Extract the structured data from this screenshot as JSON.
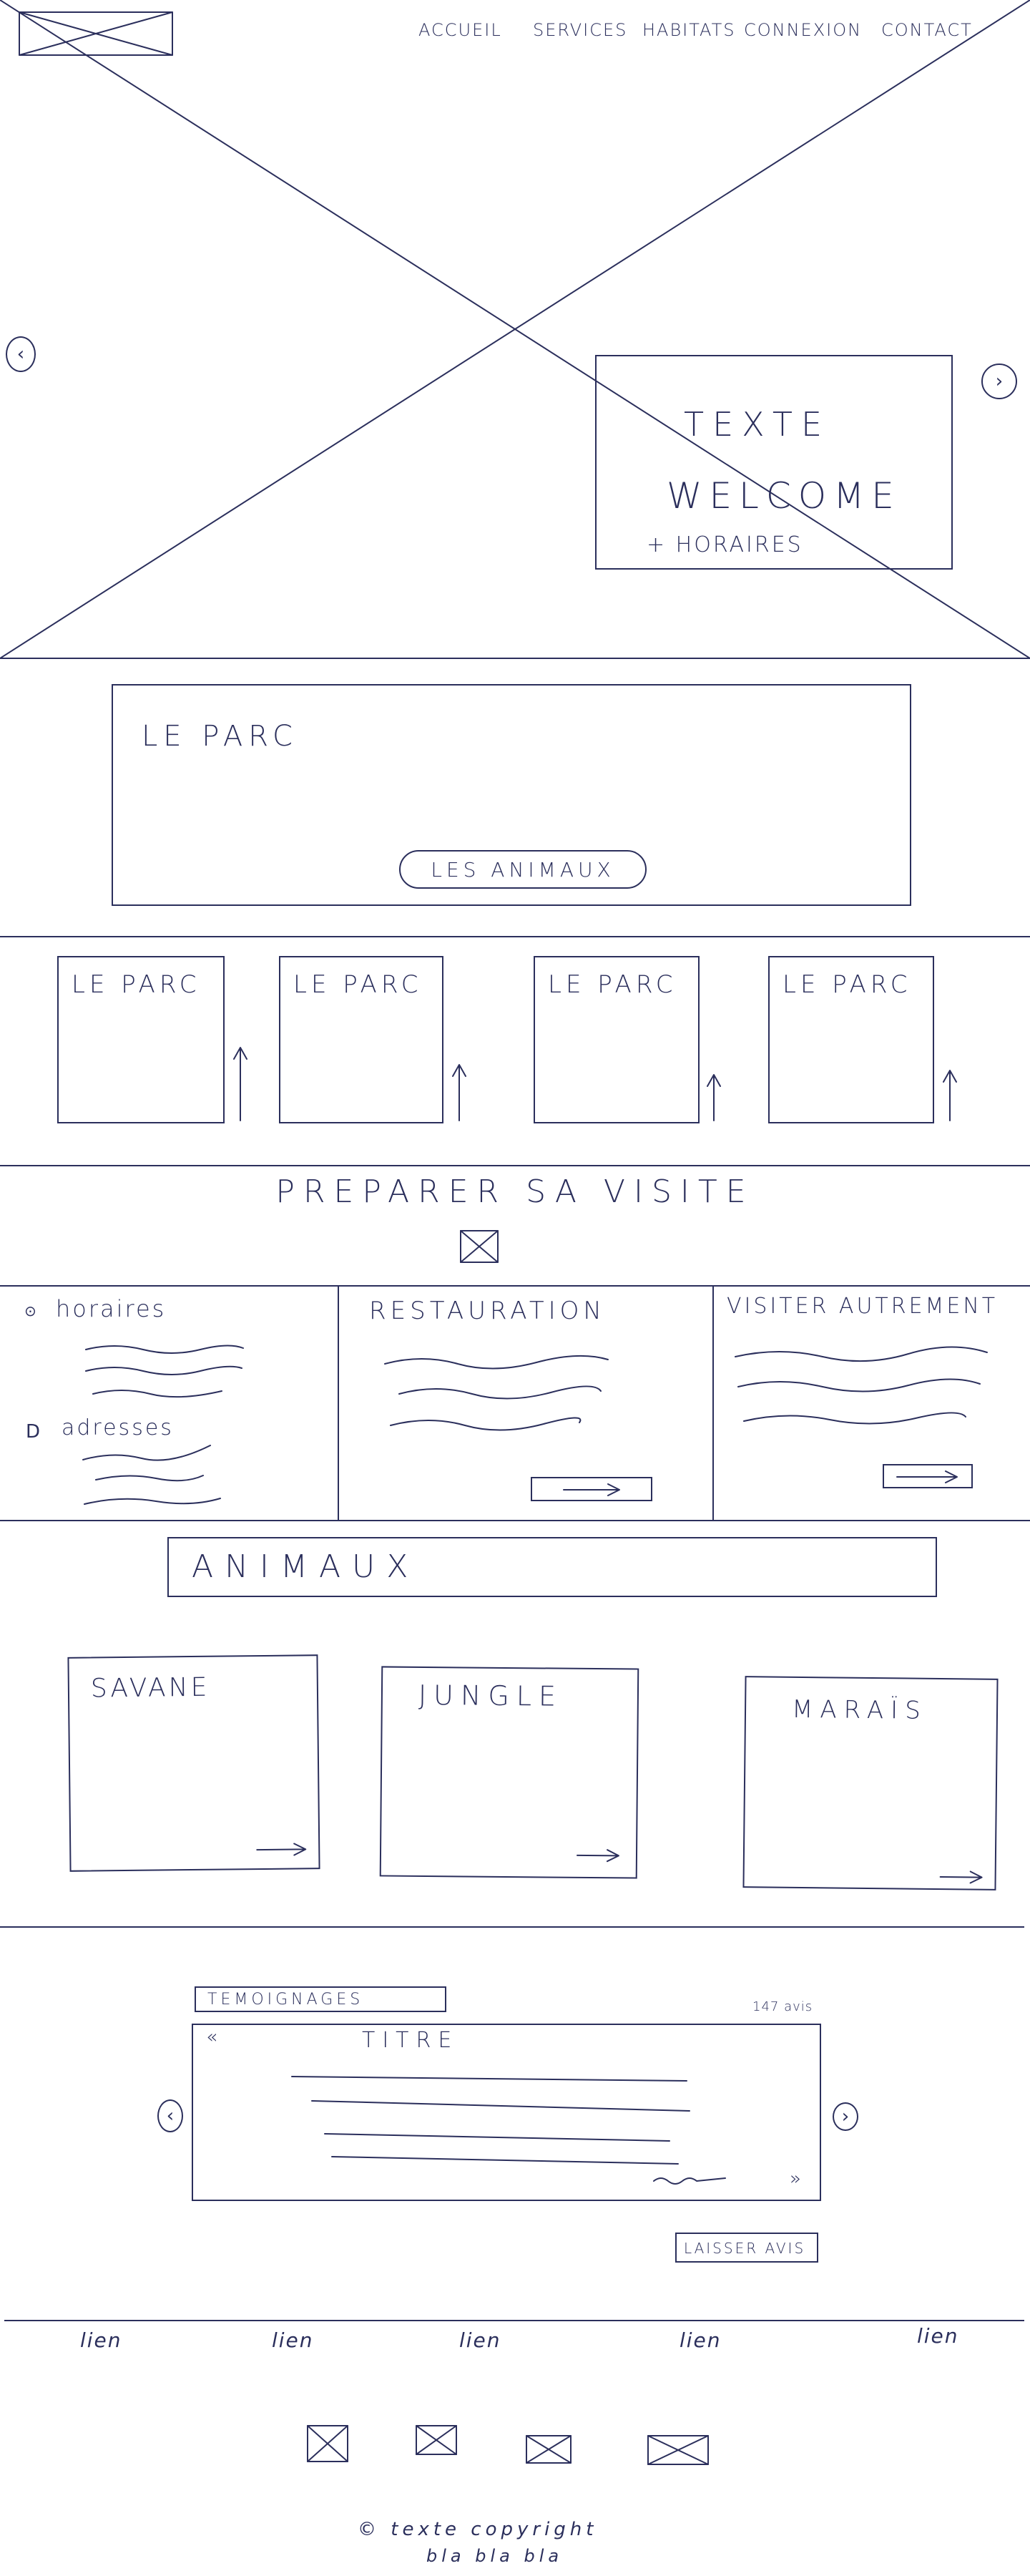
{
  "header": {
    "logo_icon": "image-placeholder-icon",
    "nav": [
      "ACCUEIL",
      "SERVICES",
      "HABITATS",
      "CONNEXION",
      "CONTACT"
    ]
  },
  "hero": {
    "prev_icon": "chevron-left-icon",
    "next_icon": "chevron-right-icon",
    "card_line1": "TEXTE",
    "card_line2": "WELCOME",
    "card_line3": "+ HORAIRES"
  },
  "park": {
    "title": "LE PARC",
    "button": "LES ANIMAUX"
  },
  "park_cards": [
    {
      "title": "LE PARC"
    },
    {
      "title": "LE PARC"
    },
    {
      "title": "LE PARC"
    },
    {
      "title": "LE PARC"
    }
  ],
  "visit": {
    "title": "PREPARER SA VISITE",
    "icon": "image-placeholder-icon",
    "col1_label1": "horaires",
    "col1_label2": "adresses",
    "col2_title": "RESTAURATION",
    "col3_title": "VISITER AUTREMENT"
  },
  "animals": {
    "title": "ANIMAUX",
    "cards": [
      {
        "title": "SAVANE"
      },
      {
        "title": "JUNGLE"
      },
      {
        "title": "MARAÏS"
      }
    ]
  },
  "testimonials": {
    "label": "TEMOIGNAGES",
    "count": "147 avis",
    "open_quote": "«",
    "close_quote": "»",
    "title": "TITRE",
    "button": "LAISSER AVIS"
  },
  "footer": {
    "links": [
      "lien",
      "lien",
      "lien",
      "lien",
      "lien"
    ],
    "copyright": "© texte copyright",
    "subtext": "bla bla bla"
  }
}
